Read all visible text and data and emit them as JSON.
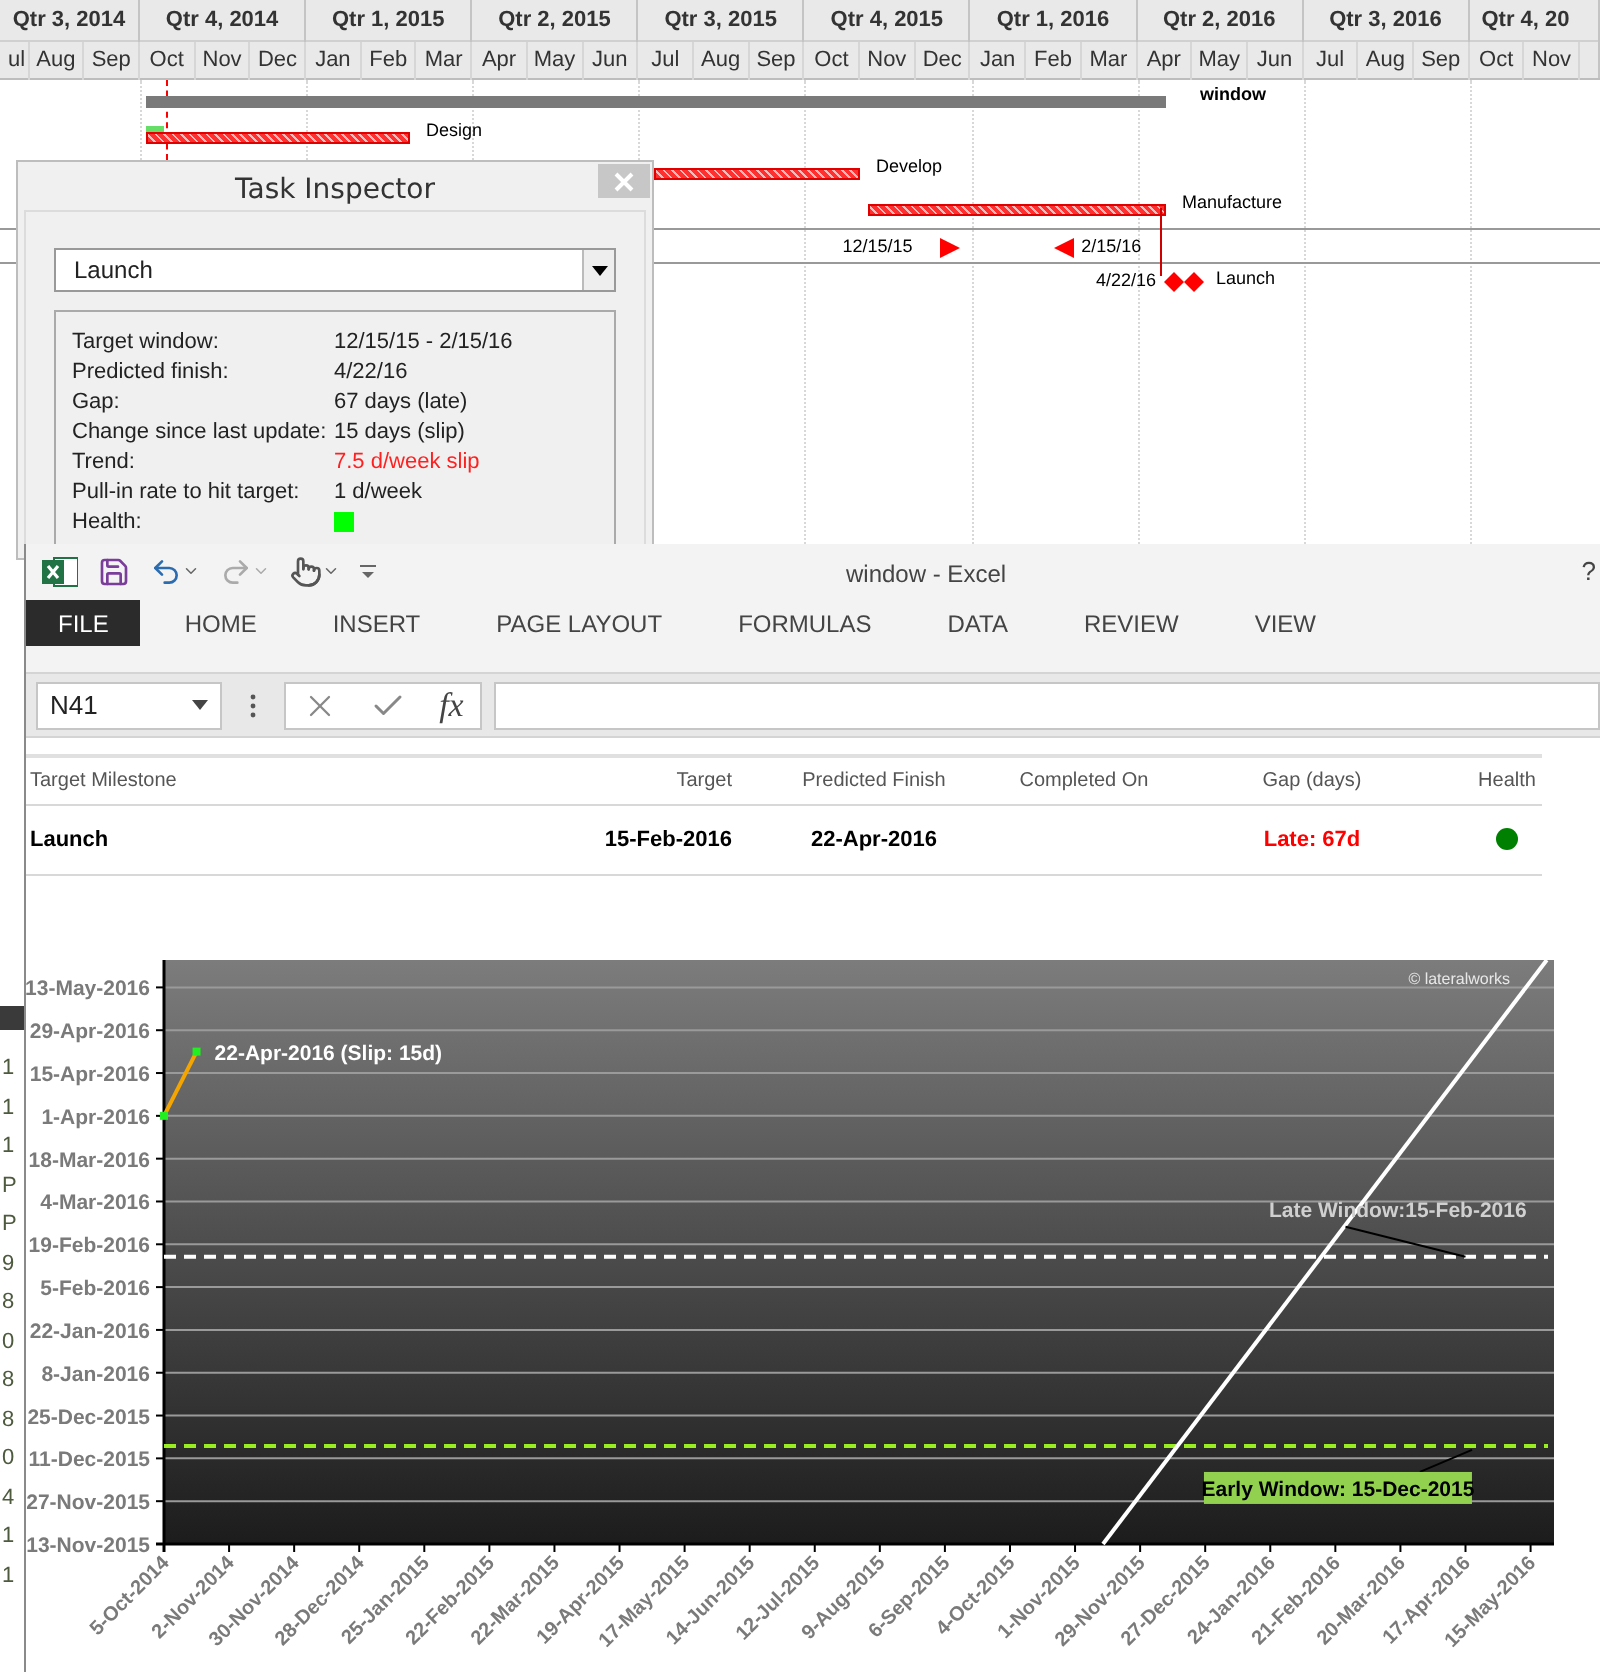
{
  "gantt": {
    "quarters": [
      {
        "label": "Qtr 3, 2014",
        "clipped": false,
        "months": [
          {
            "label": "ul",
            "clipped": true
          },
          {
            "label": "Aug",
            "clipped": false
          },
          {
            "label": "Sep",
            "clipped": false
          }
        ]
      },
      {
        "label": "Qtr 4, 2014",
        "clipped": false,
        "months": [
          {
            "label": "Oct",
            "clipped": false
          },
          {
            "label": "Nov",
            "clipped": false
          },
          {
            "label": "Dec",
            "clipped": false
          }
        ]
      },
      {
        "label": "Qtr 1, 2015",
        "clipped": false,
        "months": [
          {
            "label": "Jan",
            "clipped": false
          },
          {
            "label": "Feb",
            "clipped": false
          },
          {
            "label": "Mar",
            "clipped": false
          }
        ]
      },
      {
        "label": "Qtr 2, 2015",
        "clipped": false,
        "months": [
          {
            "label": "Apr",
            "clipped": false
          },
          {
            "label": "May",
            "clipped": false
          },
          {
            "label": "Jun",
            "clipped": false
          }
        ]
      },
      {
        "label": "Qtr 3, 2015",
        "clipped": false,
        "months": [
          {
            "label": "Jul",
            "clipped": false
          },
          {
            "label": "Aug",
            "clipped": false
          },
          {
            "label": "Sep",
            "clipped": false
          }
        ]
      },
      {
        "label": "Qtr 4, 2015",
        "clipped": false,
        "months": [
          {
            "label": "Oct",
            "clipped": false
          },
          {
            "label": "Nov",
            "clipped": false
          },
          {
            "label": "Dec",
            "clipped": false
          }
        ]
      },
      {
        "label": "Qtr 1, 2016",
        "clipped": false,
        "months": [
          {
            "label": "Jan",
            "clipped": false
          },
          {
            "label": "Feb",
            "clipped": false
          },
          {
            "label": "Mar",
            "clipped": false
          }
        ]
      },
      {
        "label": "Qtr 2, 2016",
        "clipped": false,
        "months": [
          {
            "label": "Apr",
            "clipped": false
          },
          {
            "label": "May",
            "clipped": false
          },
          {
            "label": "Jun",
            "clipped": false
          }
        ]
      },
      {
        "label": "Qtr 3, 2016",
        "clipped": false,
        "months": [
          {
            "label": "Jul",
            "clipped": false
          },
          {
            "label": "Aug",
            "clipped": false
          },
          {
            "label": "Sep",
            "clipped": false
          }
        ]
      },
      {
        "label": "Qtr 4, 20",
        "clipped": true,
        "months": [
          {
            "label": "Oct",
            "clipped": false
          },
          {
            "label": "Nov",
            "clipped": false
          }
        ]
      }
    ],
    "rows": [
      {
        "kind": "summary",
        "name": "window"
      },
      {
        "kind": "task",
        "name": "Design",
        "level": 0.07
      },
      {
        "kind": "task",
        "name": "Develop"
      },
      {
        "kind": "task",
        "name": "Manufacture"
      },
      {
        "kind": "window",
        "start": "12/15/15",
        "finish": "2/15/16"
      },
      {
        "kind": "milestone",
        "name": "Launch",
        "label": "4/22/16"
      }
    ]
  },
  "inspector": {
    "title": "Task Inspector",
    "selected_task": "Launch",
    "rows": [
      {
        "label": "Target window:",
        "value": "12/15/15 - 2/15/16",
        "kind": "text"
      },
      {
        "label": "Predicted finish:",
        "value": "4/22/16",
        "kind": "text"
      },
      {
        "label": "Gap:",
        "value": "67 days (late)",
        "kind": "text"
      },
      {
        "label": "Change since last update:",
        "value": "15 days (slip)",
        "kind": "text"
      },
      {
        "label": "Trend:",
        "value": "7.5 d/week slip",
        "kind": "alert"
      },
      {
        "label": "Pull-in rate to hit target:",
        "value": "1 d/week",
        "kind": "text"
      },
      {
        "label": "Health:",
        "kind": "swatch",
        "color": "#00ff00"
      }
    ]
  },
  "background_cells": [
    "1",
    "1",
    "1",
    "P",
    "P",
    "9",
    "8",
    "0",
    "8",
    "8",
    "0",
    "4",
    "1",
    "1"
  ],
  "excel": {
    "title": "window - Excel",
    "help": "?",
    "tabs": [
      {
        "label": "FILE",
        "selected": true
      },
      {
        "label": "HOME",
        "selected": false
      },
      {
        "label": "INSERT",
        "selected": false
      },
      {
        "label": "PAGE LAYOUT",
        "selected": false
      },
      {
        "label": "FORMULAS",
        "selected": false
      },
      {
        "label": "DATA",
        "selected": false
      },
      {
        "label": "REVIEW",
        "selected": false
      },
      {
        "label": "VIEW",
        "selected": false
      }
    ],
    "name_box": "N41",
    "function_button": "fx",
    "table": {
      "columns": [
        "Target Milestone",
        "Target",
        "Predicted Finish",
        "Completed On",
        "Gap (days)",
        "Health"
      ],
      "rows": [
        {
          "milestone": "Launch",
          "target": "15-Feb-2016",
          "predicted": "22-Apr-2016",
          "gap": "Late: 67d",
          "late": true,
          "color": "#008000"
        }
      ]
    },
    "chart": {
      "x_labels": [
        "5-Oct-2014",
        "2-Nov-2014",
        "30-Nov-2014",
        "28-Dec-2014",
        "25-Jan-2015",
        "22-Feb-2015",
        "22-Mar-2015",
        "19-Apr-2015",
        "17-May-2015",
        "14-Jun-2015",
        "12-Jul-2015",
        "9-Aug-2015",
        "6-Sep-2015",
        "4-Oct-2015",
        "1-Nov-2015",
        "29-Nov-2015",
        "27-Dec-2015",
        "24-Jan-2016",
        "21-Feb-2016",
        "20-Mar-2016",
        "17-Apr-2016",
        "15-May-2016"
      ],
      "y_labels": [
        "13-May-2016",
        "29-Apr-2016",
        "15-Apr-2016",
        "1-Apr-2016",
        "18-Mar-2016",
        "4-Mar-2016",
        "19-Feb-2016",
        "5-Feb-2016",
        "22-Jan-2016",
        "8-Jan-2016",
        "25-Dec-2015",
        "11-Dec-2015",
        "27-Nov-2015",
        "13-Nov-2015"
      ],
      "point_label": "22-Apr-2016 (Slip: 15d)",
      "late_label": "Late Window:15-Feb-2016",
      "early_label": "Early Window: 15-Dec-2015",
      "credit": "© lateralworks"
    }
  }
}
